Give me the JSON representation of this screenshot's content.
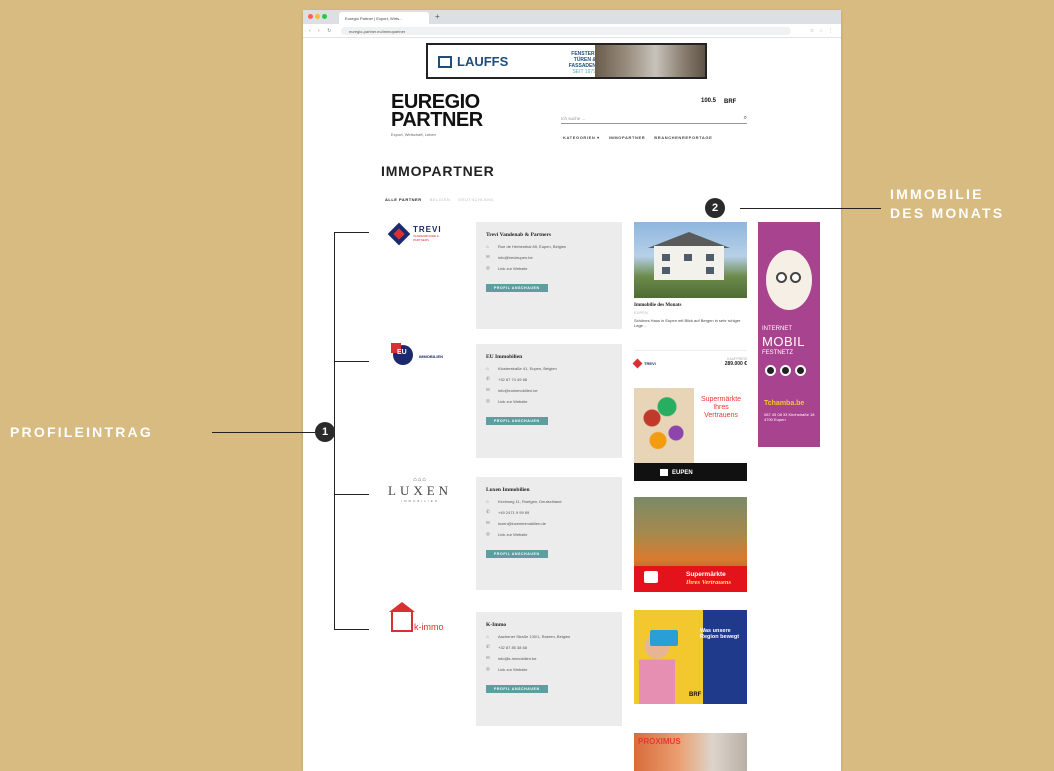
{
  "browser": {
    "tab_title": "Euregio Partner | Export, Wirts...",
    "url": "euregio-partner.eu/immopartner"
  },
  "banner": {
    "logo": "LAUFFS",
    "tagline": "FENSTER, TÜREN & FASSADEN",
    "tagline_sub": "SEIT 1979"
  },
  "header": {
    "logo_line1": "EUREGIO",
    "logo_line2": "PARTNER",
    "logo_subtitle": "Export, Wirtschaft, Leben",
    "radio_label": "100.5",
    "brf_label": "BRF",
    "search_placeholder": "Ich suche ...",
    "nav": [
      "KATEGORIEN ▾",
      "IMMOPARTNER",
      "BRANCHENREPORTAGE"
    ]
  },
  "page": {
    "title": "IMMOPARTNER",
    "filters": [
      "ALLE PARTNER",
      "BELGIEN",
      "DEUTSCHLAND"
    ]
  },
  "partners": [
    {
      "logo_text": "TREVI",
      "logo_sub": "VANDENBORRE & PARTNERS",
      "name": "Trevi Vandenab & Partners",
      "address": "Rue de Herbesthal 89, Eupen, Belgien",
      "email": "info@trevieupen.be",
      "website": "Link zur Website",
      "button": "PROFIL ANSCHAUEN"
    },
    {
      "logo_text": "EU",
      "logo_sub": "IMMOBILIEN",
      "name": "EU Immobilien",
      "address": "Klosterstraße 41, Eupen, Belgien",
      "phone": "+32 87 74 49 68",
      "email": "info@euimmobilien.be",
      "website": "Link zur Website",
      "button": "PROFIL ANSCHAUEN"
    },
    {
      "logo_text": "LUXEN",
      "logo_sub": "IMMOBILIEN",
      "name": "Luxen Immobilien",
      "address": "Kirchweg 11, Roetgen, Deutschland",
      "phone": "+49 2471 9 99 89",
      "email": "luxen@luxenimmobilien.de",
      "website": "Link zur Website",
      "button": "PROFIL ANSCHAUEN"
    },
    {
      "logo_text": "k-immo",
      "name": "K-Immo",
      "address": "Aachener Straße 130/1, Raeren, Belgien",
      "phone": "+32 87 85 38 68",
      "email": "info@k-immobilien.be",
      "website": "Link zur Website",
      "button": "PROFIL ANSCHAUEN"
    }
  ],
  "feature": {
    "title": "Immobilie des Monats",
    "location": "EUPEN",
    "desc": "Schönes Haus in Eupen mit Blick auf Bergen in sehr ruhiger Lage ...",
    "agency": "TREVI",
    "price_label": "KAUFPREIS",
    "price": "289.000 €"
  },
  "ads": {
    "supermarket_1": "Supermärkte Ihres Vertrauens",
    "supermarket_1_store": "EUPEN",
    "supermarket_2_line1": "Supermärkte",
    "supermarket_2_line2": "Ihres Vertrauens",
    "brf_text": "Was unsere Region bewegt",
    "brf_logo": "BRF",
    "bottom": "PROXIMUS",
    "sky_l1": "INTERNET",
    "sky_l2": "MOBIL",
    "sky_l3": "FESTNETZ",
    "sky_brand": "Tchamba.be",
    "sky_info": "087 45 08 33 Kirchstraße 18 4700 Eupen"
  },
  "annotations": {
    "profile_label": "PROFILEINTRAG",
    "profile_number": "1",
    "immo_label_line1": "IMMOBILIE",
    "immo_label_line2": "DES MONATS",
    "immo_number": "2"
  }
}
